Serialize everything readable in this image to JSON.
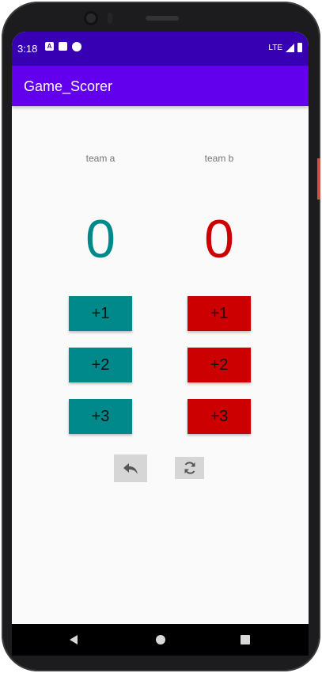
{
  "status_bar": {
    "time": "3:18",
    "left_icons": [
      "A",
      "sd-card-icon",
      "circle-icon"
    ],
    "network": "LTE"
  },
  "app_bar": {
    "title": "Game_Scorer"
  },
  "team_a": {
    "label": "team a",
    "score": "0",
    "color": "#00898a",
    "buttons": [
      "+1",
      "+2",
      "+3"
    ]
  },
  "team_b": {
    "label": "team b",
    "score": "0",
    "color": "#cc0000",
    "buttons": [
      "+1",
      "+2",
      "+3"
    ]
  },
  "actions": {
    "undo_icon": "undo-icon",
    "reset_icon": "reset-icon"
  },
  "nav_bar": {
    "icons": [
      "back-icon",
      "home-icon",
      "recents-icon"
    ]
  }
}
